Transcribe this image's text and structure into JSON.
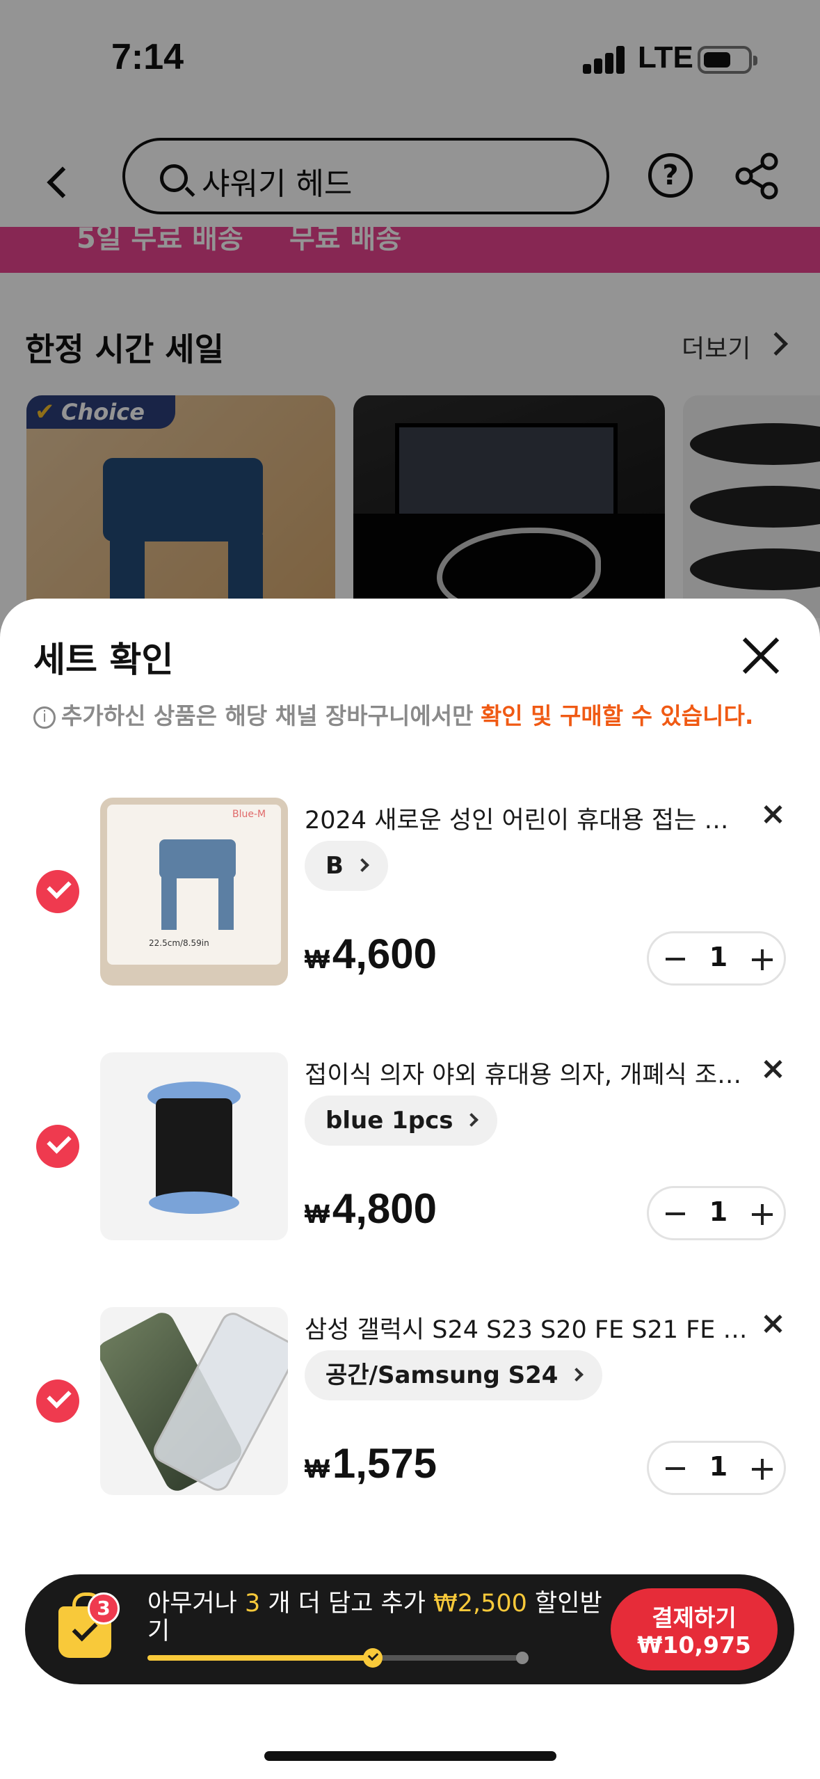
{
  "status_bar": {
    "time": "7:14",
    "network": "LTE"
  },
  "header": {
    "search_query": "샤워기 헤드"
  },
  "promo_strip": {
    "item1": "5일 무료 배송",
    "item2": "무료 배송"
  },
  "flash_sale": {
    "title": "한정 시간 세일",
    "see_more": "더보기",
    "badge": "Choice"
  },
  "sheet": {
    "title": "세트 확인",
    "info_gray": "추가하신 상품은 해당 채널 장바구니에서만",
    "info_orange": "확인 및 구매할 수 있습니다."
  },
  "items": [
    {
      "name": "2024 새로운 성인 어린이 휴대용 접는 의자 ...",
      "variant": "B",
      "currency": "₩",
      "price": "4,600",
      "qty": "1",
      "thumb_label": "Blue-M",
      "thumb_dims": "22.5cm/8.59in"
    },
    {
      "name": "접이식 의자 야외 휴대용 의자, 개폐식 조절 ...",
      "variant": "blue 1pcs",
      "currency": "₩",
      "price": "4,800",
      "qty": "1"
    },
    {
      "name": "삼성 갤럭시 S24 S23 S20 FE S21 FE S2...",
      "variant": "공간/Samsung S24",
      "currency": "₩",
      "price": "1,575",
      "qty": "1"
    }
  ],
  "cart_bar": {
    "badge_count": "3",
    "promo_prefix": "아무거나",
    "promo_count": "3",
    "promo_mid": "개 더 담고 추가",
    "promo_amount": "₩2,500",
    "promo_suffix": "할인받기",
    "progress_fraction": 0.6,
    "checkout_label": "결제하기",
    "checkout_total": "₩10,975"
  },
  "colors": {
    "accent_red": "#ef3a4f",
    "info_orange": "#f05a14",
    "promo_yellow": "#f8c93a",
    "promo_pink": "#e8448f"
  }
}
